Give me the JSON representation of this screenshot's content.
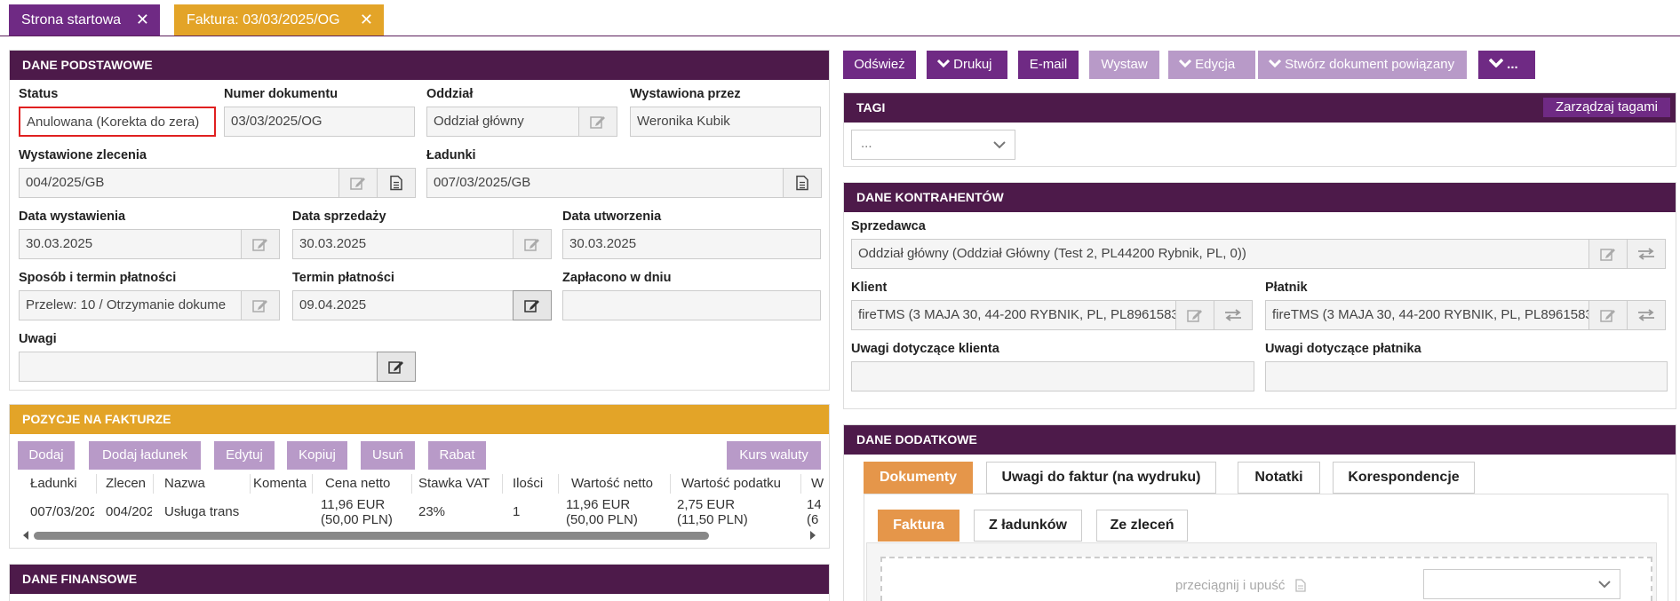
{
  "tabs": [
    {
      "label": "Strona startowa"
    },
    {
      "label": "Faktura: 03/03/2025/OG"
    }
  ],
  "basic": {
    "title": "DANE PODSTAWOWE",
    "status_label": "Status",
    "status_value": "Anulowana (Korekta do zera)",
    "docnum_label": "Numer dokumentu",
    "docnum_value": "03/03/2025/OG",
    "branch_label": "Oddział",
    "branch_value": "Oddział główny",
    "issued_by_label": "Wystawiona przez",
    "issued_by_value": "Weronika Kubik",
    "orders_label": "Wystawione zlecenia",
    "orders_value": "004/2025/GB",
    "loads_label": "Ładunki",
    "loads_value": "007/03/2025/GB",
    "issue_date_label": "Data wystawienia",
    "issue_date_value": "30.03.2025",
    "sale_date_label": "Data sprzedaży",
    "sale_date_value": "30.03.2025",
    "created_label": "Data utworzenia",
    "created_value": "30.03.2025",
    "payment_method_label": "Sposób i termin płatności",
    "payment_method_value": "Przelew: 10 / Otrzymanie dokume",
    "due_label": "Termin płatności",
    "due_value": "09.04.2025",
    "paid_label": "Zapłacono w dniu",
    "paid_value": "",
    "notes_label": "Uwagi",
    "notes_value": ""
  },
  "toolbar": {
    "refresh": "Odśwież",
    "print": "Drukuj",
    "email": "E-mail",
    "issue": "Wystaw",
    "edit": "Edycja",
    "create_related": "Stwórz dokument powiązany",
    "more": "..."
  },
  "tags": {
    "title": "TAGI",
    "manage": "Zarządzaj tagami",
    "select": "..."
  },
  "parties": {
    "title": "DANE KONTRAHENTÓW",
    "seller_label": "Sprzedawca",
    "seller_value": "Oddział główny  (Oddział Główny  (Test 2, PL44200 Rybnik, PL, 0))",
    "client_label": "Klient",
    "client_value": "fireTMS (3 MAJA 30, 44-200 RYBNIK, PL, PL8961583",
    "payer_label": "Płatnik",
    "payer_value": "fireTMS (3 MAJA 30, 44-200 RYBNIK, PL, PL8961583",
    "client_notes_label": "Uwagi dotyczące klienta",
    "payer_notes_label": "Uwagi dotyczące płatnika"
  },
  "items": {
    "title": "POZYCJE NA FAKTURZE",
    "buttons": {
      "add": "Dodaj",
      "add_load": "Dodaj ładunek",
      "edit": "Edytuj",
      "copy": "Kopiuj",
      "delete": "Usuń",
      "discount": "Rabat",
      "currency": "Kurs waluty"
    },
    "columns": [
      "Ładunki",
      "Zlecen",
      "Nazwa",
      "Komenta",
      "Cena netto",
      "Stawka VAT",
      "Ilości",
      "Wartość netto",
      "Wartość podatku",
      "W"
    ],
    "rows": [
      {
        "load": "007/03/202",
        "order": "004/202",
        "name": "Usługa trans",
        "comment": "",
        "price_a": "11,96 EUR",
        "price_b": "(50,00 PLN)",
        "vat": "23%",
        "qty": "1",
        "net_a": "11,96 EUR",
        "net_b": "(50,00 PLN)",
        "tax_a": "2,75 EUR",
        "tax_b": "(11,50 PLN)",
        "gross_a": "14",
        "gross_b": "(6"
      }
    ]
  },
  "finance": {
    "title": "DANE FINANSOWE"
  },
  "extra": {
    "title": "DANE DODATKOWE",
    "tabs": [
      "Dokumenty",
      "Uwagi do faktur (na wydruku)",
      "Notatki",
      "Korespondencje"
    ],
    "subtabs": [
      "Faktura",
      "Z ładunków",
      "Ze zleceń"
    ],
    "drop_text": "przeciągnij i upuść"
  },
  "colors": {
    "purple": "#4d1a4a",
    "accent_purple": "#6f2a84",
    "light_purple": "#b89ac8",
    "gold": "#e3a428",
    "orange": "#e5964a",
    "red_highlight": "#e02020"
  }
}
